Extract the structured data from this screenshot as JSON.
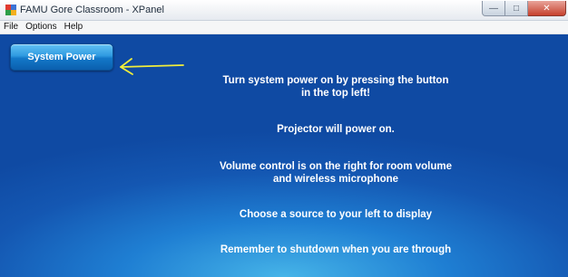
{
  "window": {
    "title": "FAMU Gore Classroom - XPanel",
    "minimize_glyph": "—",
    "maximize_glyph": "□",
    "close_glyph": "✕"
  },
  "menu": {
    "items": [
      "File",
      "Options",
      "Help"
    ]
  },
  "panel": {
    "power_button_label": "System Power",
    "messages": [
      "Turn system power on by pressing the button\nin the top left!",
      "Projector will power on.",
      "Volume control is on the right for room volume\nand wireless microphone",
      "Choose a source to your left to display",
      "Remember to shutdown when you are through"
    ]
  },
  "colors": {
    "panel_blue": "#1a6cc4",
    "button_blue": "#2f9ae0",
    "arrow_yellow": "#f2ee3a",
    "text": "#ffffff"
  }
}
